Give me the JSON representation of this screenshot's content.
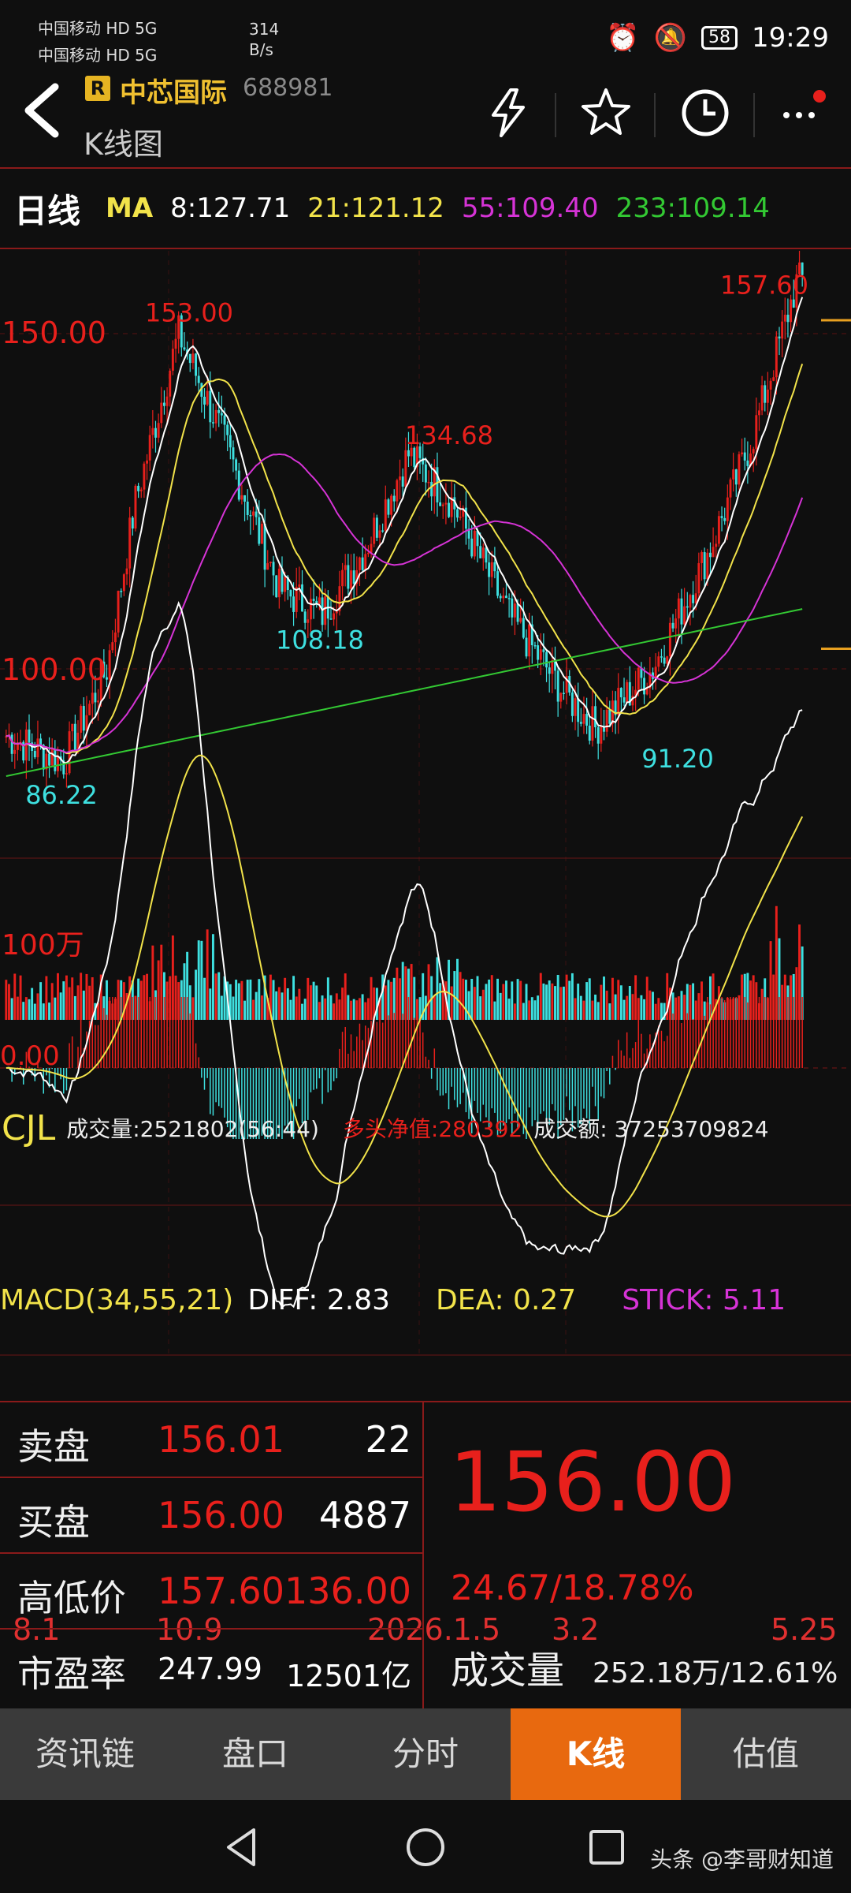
{
  "status_bar": {
    "carrier1": "中国移动 HD 5G",
    "carrier2": "中国移动 HD 5G",
    "speed": "314 B/s",
    "battery": "58",
    "time": "19:29"
  },
  "header": {
    "badge": "R",
    "stock_name": "中芯国际",
    "stock_code": "688981",
    "subtitle": "K线图"
  },
  "ma_bar": {
    "period": "日线",
    "ma_label": "MA",
    "ma8": "8:127.71",
    "ma21": "21:121.12",
    "ma55": "55:109.40",
    "ma233": "233:109.14"
  },
  "kline": {
    "price_labels": [
      "150.00",
      "100.00"
    ],
    "annotations": [
      "157.60",
      "153.00",
      "134.68",
      "108.18",
      "91.20",
      "86.22"
    ]
  },
  "cjl": {
    "title": "CJL",
    "volume": "成交量:2521802(56:44)",
    "net": "多头净值:280392",
    "amount": "成交额: 37253709824",
    "scale": "100万"
  },
  "macd": {
    "title": "MACD(34,55,21)",
    "diff": "DIFF: 2.83",
    "dea": "DEA: 0.27",
    "stick": "STICK: 5.11",
    "zero_label": "0.00"
  },
  "dates": [
    "8.1",
    "10.9",
    "2026.1.5",
    "3.2",
    "5.25"
  ],
  "quote": {
    "sell_label": "卖盘",
    "sell_price": "156.01",
    "sell_qty": "22",
    "buy_label": "买盘",
    "buy_price": "156.00",
    "buy_qty": "4887",
    "hl_label": "高低价",
    "high": "157.60",
    "low": "136.00",
    "pe_label": "市盈率",
    "pe": "247.99",
    "cap": "12501亿",
    "last_price": "156.00",
    "change": "24.67/18.78%",
    "vol_label": "成交量",
    "vol_value": "252.18万/12.61%"
  },
  "tabs": [
    "资讯链",
    "盘口",
    "分时",
    "K线",
    "估值"
  ],
  "active_tab": "K线",
  "watermark": "头条 @李哥财知道",
  "colors": {
    "up": "#e8201c",
    "down": "#3ee0e0",
    "ma8": "#ffffff",
    "ma21": "#f2e34a",
    "ma55": "#d633d6",
    "ma233": "#33c933",
    "accent": "#e8690f"
  }
}
